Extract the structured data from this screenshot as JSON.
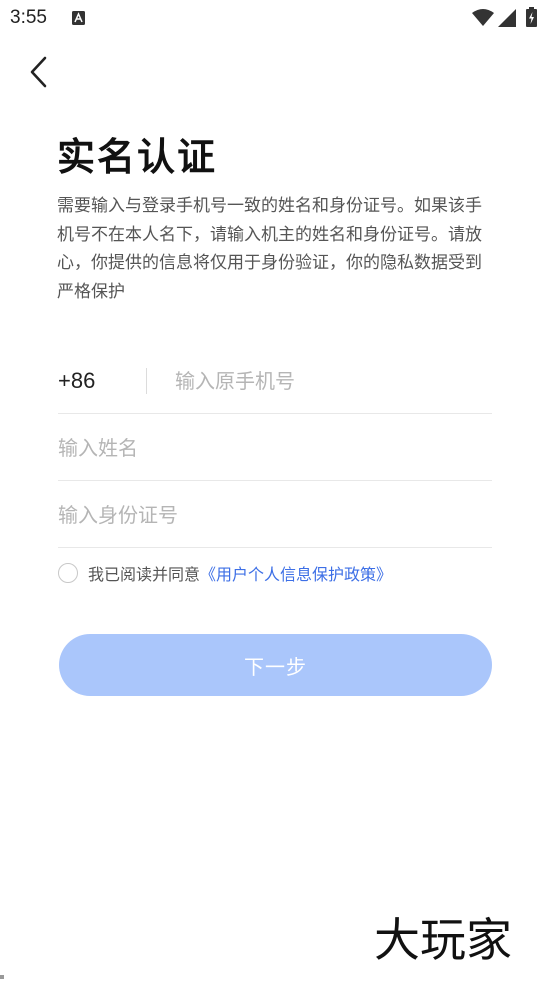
{
  "status_bar": {
    "time": "3:55",
    "icons": [
      "a-notification-icon",
      "wifi-icon",
      "signal-icon",
      "battery-charging-icon"
    ]
  },
  "header": {
    "back_icon": "chevron-left-icon"
  },
  "title": "实名认证",
  "description": "需要输入与登录手机号一致的姓名和身份证号。如果该手机号不在本人名下，请输入机主的姓名和身份证号。请放心，你提供的信息将仅用于身份验证，你的隐私数据受到严格保护",
  "form": {
    "country_code": "+86",
    "phone_placeholder": "输入原手机号",
    "name_placeholder": "输入姓名",
    "id_placeholder": "输入身份证号"
  },
  "agreement": {
    "text": "我已阅读并同意",
    "link": "《用户个人信息保护政策》",
    "checked": false
  },
  "next_button": {
    "label": "下一步",
    "enabled": false
  },
  "watermark": "大玩家",
  "colors": {
    "link": "#3d6fe6",
    "button_disabled": "#aac6fb",
    "placeholder": "#b5b5b5"
  }
}
